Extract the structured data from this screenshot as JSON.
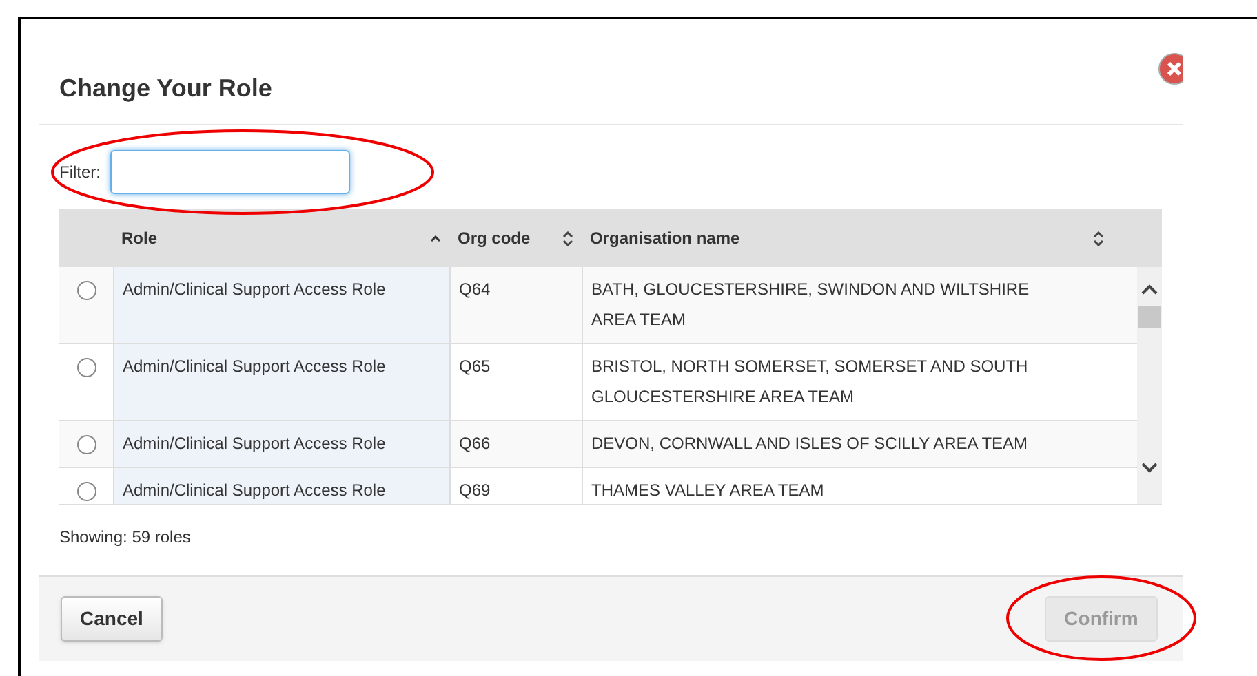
{
  "dialog": {
    "title": "Change Your Role"
  },
  "filter": {
    "label": "Filter:",
    "focused": true
  },
  "table": {
    "columns": [
      {
        "label": "Role",
        "sorted": true
      },
      {
        "label": "Org code",
        "sorted": false
      },
      {
        "label": "Organisation name",
        "sorted": false
      }
    ],
    "rows": [
      {
        "selected": false,
        "cells": [
          "Admin/Clinical Support Access Role",
          "Q64",
          "BATH, GLOUCESTERSHIRE, SWINDON AND WILTSHIRE AREA TEAM"
        ]
      },
      {
        "selected": false,
        "cells": [
          "Admin/Clinical Support Access Role",
          "Q65",
          "BRISTOL, NORTH SOMERSET, SOMERSET AND SOUTH GLOUCESTERSHIRE AREA TEAM"
        ]
      },
      {
        "selected": false,
        "cells": [
          "Admin/Clinical Support Access Role",
          "Q66",
          "DEVON, CORNWALL AND ISLES OF SCILLY AREA TEAM"
        ]
      },
      {
        "selected": false,
        "cells": [
          "Admin/Clinical Support Access Role",
          "Q69",
          "THAMES VALLEY AREA TEAM"
        ]
      }
    ]
  },
  "count": "Showing: 59 roles",
  "buttons": [
    {
      "label": "Cancel",
      "disabled": false
    },
    {
      "label": "Confirm",
      "disabled": true
    }
  ]
}
